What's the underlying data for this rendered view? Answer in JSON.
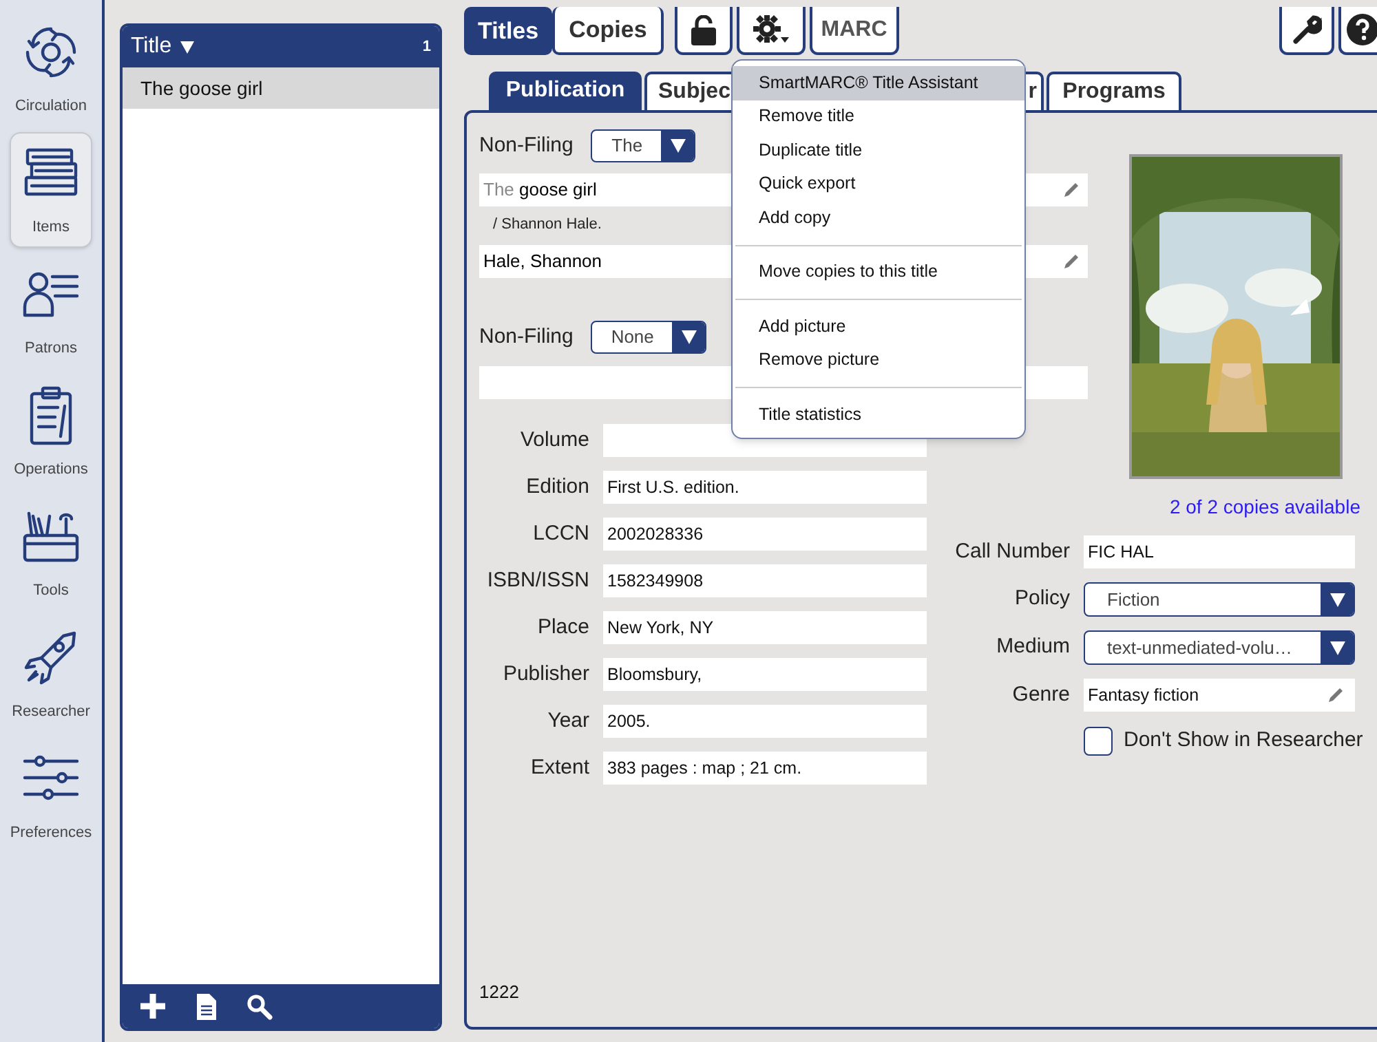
{
  "nav": [
    {
      "label": "Circulation",
      "selected": false
    },
    {
      "label": "Items",
      "selected": true
    },
    {
      "label": "Patrons",
      "selected": false
    },
    {
      "label": "Operations",
      "selected": false
    },
    {
      "label": "Tools",
      "selected": false
    },
    {
      "label": "Researcher",
      "selected": false
    },
    {
      "label": "Preferences",
      "selected": false
    }
  ],
  "list": {
    "header": "Title",
    "count": "1",
    "rows": [
      {
        "text": "The goose girl",
        "selected": true
      }
    ]
  },
  "top_tabs": [
    {
      "label": "Titles",
      "selected": true
    },
    {
      "label": "Copies",
      "selected": false
    }
  ],
  "marc_button": "MARC",
  "subtabs": [
    {
      "label": "Publication",
      "selected": true
    },
    {
      "label": "Subjec",
      "selected": false
    },
    {
      "label": "r",
      "selected": false
    },
    {
      "label": "Programs",
      "selected": false
    }
  ],
  "title_section": {
    "nonfiling_label": "Non-Filing",
    "nonfiling_value": "The",
    "title_prefix": "The",
    "title_rest": "goose girl",
    "statement": "/ Shannon Hale.",
    "author": "Hale, Shannon"
  },
  "series_section": {
    "nonfiling_label": "Non-Filing",
    "nonfiling_value": "None"
  },
  "fields": [
    {
      "label": "Volume"
    },
    {
      "label": "Edition",
      "value": "First U.S. edition."
    },
    {
      "label": "LCCN",
      "value": "2002028336"
    },
    {
      "label": "ISBN/ISSN",
      "value": "1582349908"
    },
    {
      "label": "Place",
      "value": "New York, NY"
    },
    {
      "label": "Publisher",
      "value": "Bloomsbury,"
    },
    {
      "label": "Year",
      "value": "2005."
    },
    {
      "label": "Extent",
      "value": "383 pages : map ; 21 cm."
    }
  ],
  "copies_available": "2 of 2 copies available",
  "right_fields": [
    {
      "kind": "text",
      "label": "Call Number",
      "value": "FIC HAL"
    },
    {
      "kind": "select",
      "label": "Policy",
      "value": "Fiction"
    },
    {
      "kind": "select",
      "label": "Medium",
      "value": "text-unmediated-volu…"
    },
    {
      "kind": "edit",
      "label": "Genre",
      "value": "Fantasy fiction"
    }
  ],
  "hide_in_researcher": {
    "label": "Don't Show in Researcher",
    "checked": false
  },
  "record_id": "1222",
  "menu": {
    "groups": [
      [
        {
          "label": "SmartMARC® Title Assistant",
          "selected": true
        },
        {
          "label": "Remove title",
          "selected": false
        },
        {
          "label": "Duplicate title",
          "selected": false
        },
        {
          "label": "Quick export",
          "selected": false
        },
        {
          "label": "Add copy",
          "selected": false
        }
      ],
      [
        {
          "label": "Move copies to this title",
          "selected": false
        }
      ],
      [
        {
          "label": "Add picture",
          "selected": false
        },
        {
          "label": "Remove picture",
          "selected": false
        }
      ],
      [
        {
          "label": "Title statistics",
          "selected": false
        }
      ]
    ]
  }
}
